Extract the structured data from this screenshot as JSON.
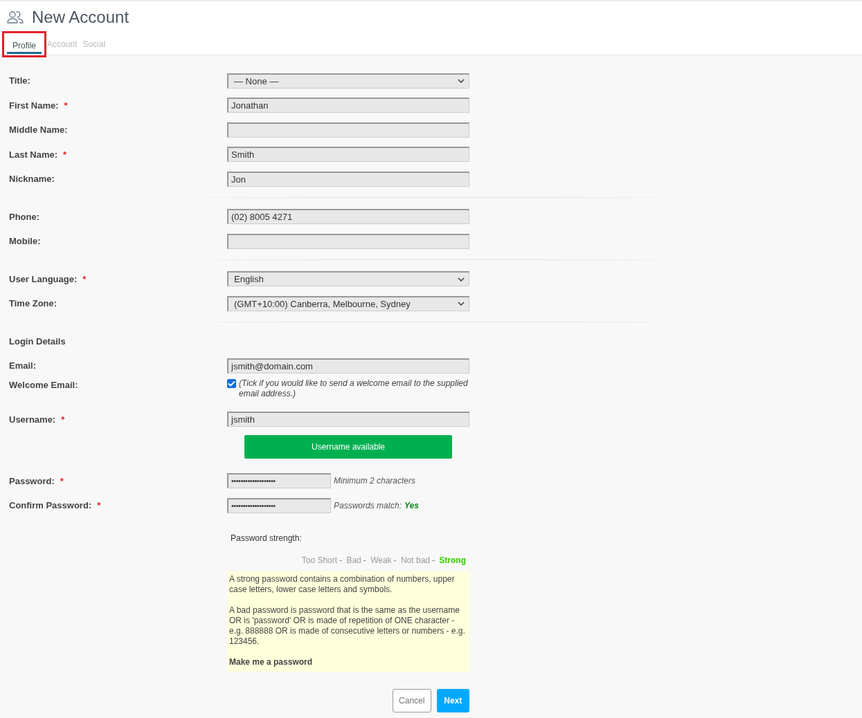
{
  "header": {
    "title": "New Account"
  },
  "tabs": [
    {
      "label": "Profile",
      "selected": true,
      "highlighted": true
    },
    {
      "label": "Account",
      "selected": false,
      "highlighted": false
    },
    {
      "label": "Social",
      "selected": false,
      "highlighted": false
    }
  ],
  "sections": [
    {
      "rows": [
        {
          "kind": "select",
          "label": "Title:",
          "value": "— None —"
        },
        {
          "kind": "text",
          "label": "First Name:",
          "required_mark": "*",
          "value": "Jonathan"
        },
        {
          "kind": "text",
          "label": "Middle Name:"
        },
        {
          "kind": "text",
          "label": "Last Name:",
          "required_mark": "*",
          "value": "Smith"
        },
        {
          "kind": "text",
          "label": "Nickname:",
          "value": "Jon"
        }
      ]
    },
    {
      "rows": [
        {
          "kind": "text",
          "label": "Phone:",
          "value": "(02) 8005 4271"
        },
        {
          "kind": "text",
          "label": "Mobile:"
        }
      ]
    },
    {
      "rows": [
        {
          "kind": "select",
          "label": "User Language:",
          "required_mark": "*",
          "value": "English"
        },
        {
          "kind": "select",
          "label": "Time Zone:",
          "value": "(GMT+10:00) Canberra, Melbourne, Sydney"
        }
      ]
    },
    {
      "rows": [
        {
          "kind": "heading",
          "text": "Login Details"
        },
        {
          "kind": "text",
          "label": "Email:",
          "value": "jsmith@domain.com"
        },
        {
          "kind": "checkbox",
          "label": "Welcome Email:",
          "checked": true,
          "note": "(Tick if you would like to send a welcome email to the supplied email address.)"
        },
        {
          "kind": "text",
          "label": "Username:",
          "required_mark": "*",
          "value": "jsmith"
        },
        {
          "kind": "button",
          "text": "Username available"
        },
        {
          "kind": "password",
          "label": "Password:",
          "required_mark": "*",
          "value": "•••••••••••••••••••",
          "hint": "Minimum 2 characters"
        },
        {
          "kind": "password",
          "label": "Confirm Password:",
          "required_mark": "*",
          "value": "•••••••••••••••••••",
          "hint": "Passwords match:",
          "hint_status": "Yes"
        }
      ]
    }
  ],
  "password_strength": {
    "label": "Password strength:",
    "separator": "-",
    "levels": [
      {
        "label": "Too Short",
        "selected": false
      },
      {
        "label": "Bad",
        "selected": false
      },
      {
        "label": "Weak",
        "selected": false
      },
      {
        "label": "Not bad",
        "selected": false
      },
      {
        "label": "Strong",
        "selected": true
      }
    ],
    "info": [
      "A strong password contains a combination of numbers, upper case letters, lower case letters and symbols.",
      "A bad password is password that is the same as the username OR is 'password' OR is made of repetition of ONE character - e.g. 888888 OR is made of consecutive letters or numbers - e.g. 123456."
    ],
    "link": "Make me a password"
  },
  "actions": {
    "cancel": "Cancel",
    "next": "Next"
  }
}
